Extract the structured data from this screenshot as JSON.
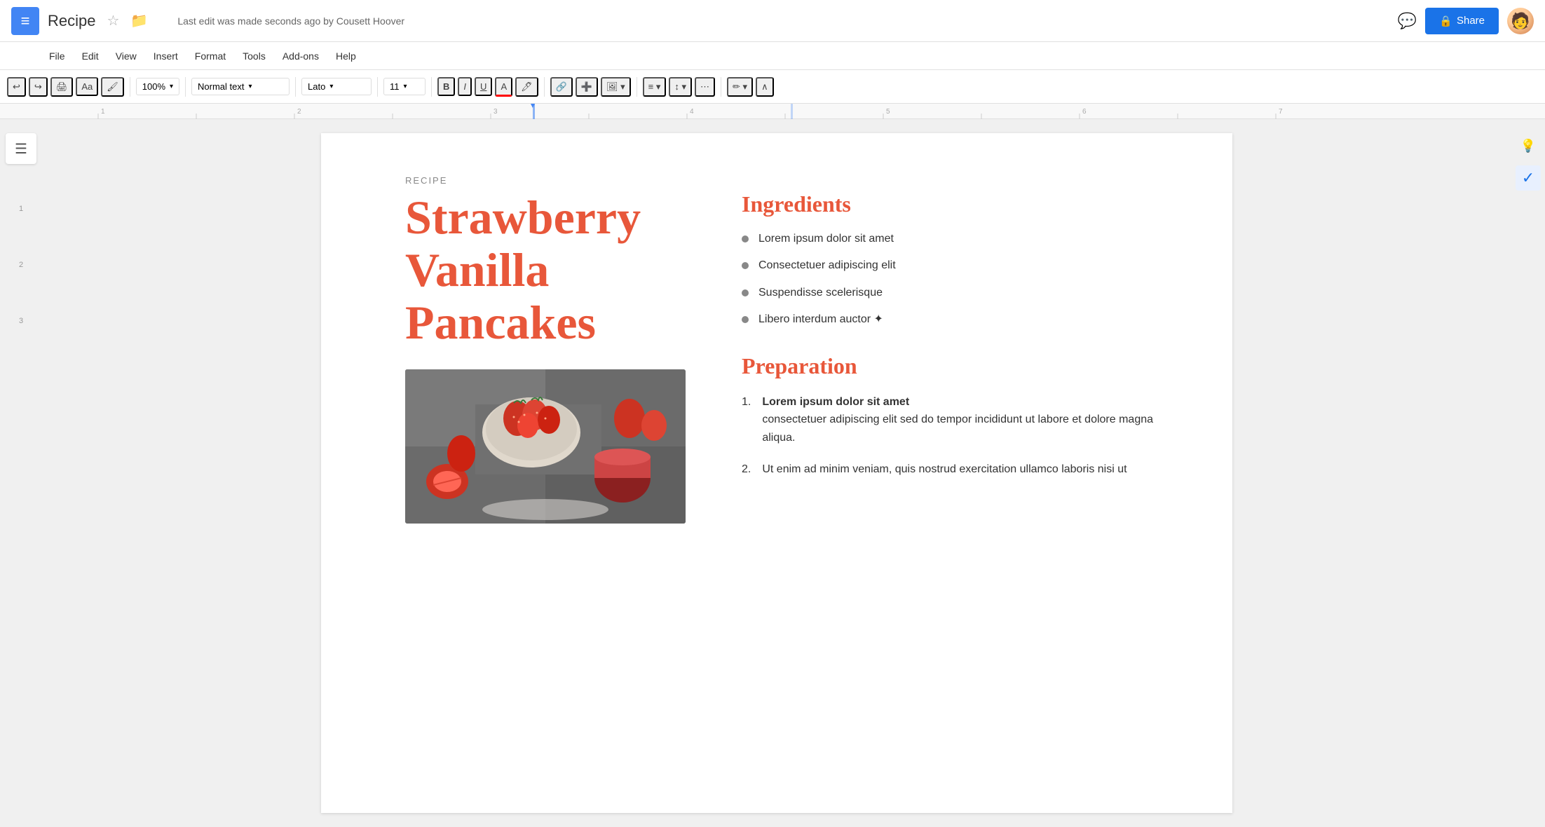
{
  "app": {
    "icon_text": "≡",
    "title": "Recipe",
    "star_icon": "☆",
    "folder_icon": "📁",
    "save_status": "Last edit was made seconds ago by Cousett Hoover"
  },
  "topbar": {
    "comments_icon": "💬",
    "share_button": "Share",
    "lock_icon": "🔒"
  },
  "menu": {
    "items": [
      "File",
      "Edit",
      "View",
      "Insert",
      "Format",
      "Tools",
      "Add-ons",
      "Help"
    ]
  },
  "toolbar": {
    "undo": "↩",
    "redo": "↪",
    "print": "🖨",
    "paint_format": "🖌",
    "zoom": "100%",
    "zoom_arrow": "▾",
    "style": "Normal text",
    "style_arrow": "▾",
    "font": "Lato",
    "font_arrow": "▾",
    "font_size": "11",
    "font_size_arrow": "▾",
    "bold": "B",
    "italic": "I",
    "underline": "U",
    "text_color": "A",
    "highlight": "🖊",
    "link": "🔗",
    "insert_comment": "➕",
    "insert_image": "🖼",
    "align": "≡",
    "line_spacing": "↕",
    "more": "⋯",
    "pen": "✏",
    "collapse": "∧"
  },
  "document": {
    "recipe_label": "RECIPE",
    "title_line1": "Strawberry",
    "title_line2": "Vanilla",
    "title_line3": "Pancakes",
    "ingredients_heading": "Ingredients",
    "ingredients": [
      "Lorem ipsum dolor sit amet",
      "Consectetuer adipiscing elit",
      "Suspendisse scelerisque",
      "Libero interdum auctor ✦"
    ],
    "preparation_heading": "Preparation",
    "preparation_steps": [
      {
        "num": "1.",
        "bold": "Lorem ipsum dolor sit amet",
        "text": "consectetuer adipiscing elit sed do tempor incididunt ut labore et dolore magna aliqua."
      },
      {
        "num": "2.",
        "bold": "",
        "text": "Ut enim ad minim veniam, quis nostrud exercitation ullamco laboris nisi ut"
      }
    ]
  },
  "sidebar": {
    "outline_icon": "☰",
    "ruler_numbers": [
      "",
      "1",
      "",
      "2",
      "",
      "3"
    ]
  },
  "right_panel": {
    "lightbulb_icon": "💡",
    "check_icon": "✓"
  }
}
